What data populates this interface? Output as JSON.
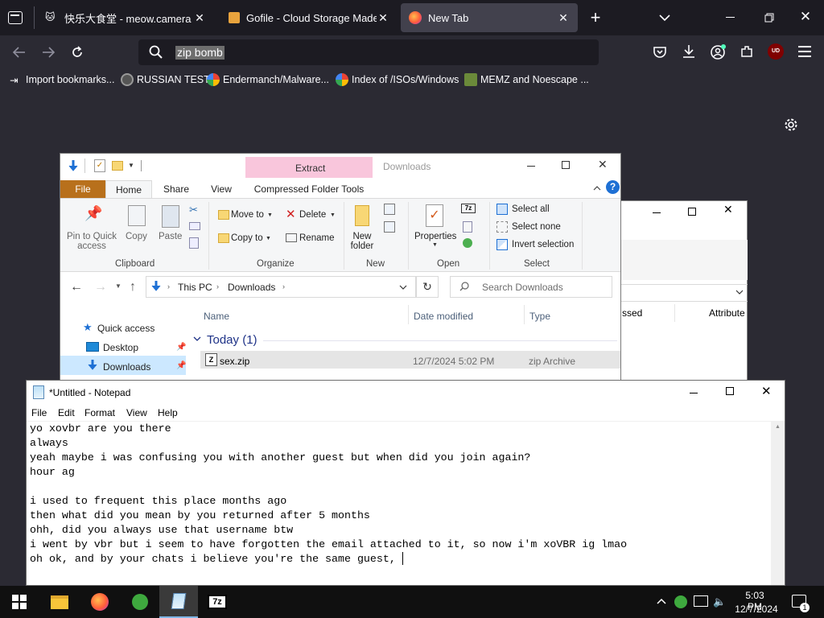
{
  "browser": {
    "tabs": [
      {
        "title": "快乐大食堂 - meow.camera",
        "active": false
      },
      {
        "title": "Gofile - Cloud Storage Made Sim",
        "active": false
      },
      {
        "title": "New Tab",
        "active": true
      }
    ],
    "url_text": "zip bomb",
    "bookmarks": [
      {
        "label": "Import bookmarks..."
      },
      {
        "label": "RUSSIAN TEST"
      },
      {
        "label": "Endermanch/Malware..."
      },
      {
        "label": "Index of /ISOs/Windows"
      },
      {
        "label": "MEMZ and Noescape ..."
      }
    ],
    "ublock_badge": "UD"
  },
  "explorer": {
    "title": "Downloads",
    "context_tab": "Extract",
    "ribbon_tabs": {
      "file": "File",
      "home": "Home",
      "share": "Share",
      "view": "View",
      "compressed": "Compressed Folder Tools"
    },
    "clipboard": {
      "pin": "Pin to Quick access",
      "copy": "Copy",
      "paste": "Paste",
      "label": "Clipboard"
    },
    "organize": {
      "move_to": "Move to",
      "copy_to": "Copy to",
      "delete": "Delete",
      "rename": "Rename",
      "label": "Organize"
    },
    "new": {
      "new_folder": "New folder",
      "label": "New"
    },
    "open": {
      "properties": "Properties",
      "label": "Open"
    },
    "select": {
      "select_all": "Select all",
      "select_none": "Select none",
      "invert": "Invert selection",
      "label": "Select"
    },
    "breadcrumb": [
      "This PC",
      "Downloads"
    ],
    "search_placeholder": "Search Downloads",
    "columns": {
      "name": "Name",
      "date": "Date modified",
      "type": "Type"
    },
    "group": "Today (1)",
    "nav": {
      "quick_access": "Quick access",
      "desktop": "Desktop",
      "downloads": "Downloads"
    },
    "files": [
      {
        "name": "sex.zip",
        "date": "12/7/2024 5:02 PM",
        "type": "zip Archive"
      }
    ]
  },
  "explorer_back": {
    "col_accessed": "ssed",
    "col_attributes": "Attribute"
  },
  "notepad": {
    "title": "*Untitled - Notepad",
    "menu": {
      "file": "File",
      "edit": "Edit",
      "format": "Format",
      "view": "View",
      "help": "Help"
    },
    "text": "yo xovbr are you there\nalways\nyeah maybe i was confusing you with another guest but when did you join again?\nhour ag\n\ni used to frequent this place months ago\nthen what did you mean by you returned after 5 months\nohh, did you always use that username btw\ni went by vbr but i seem to have forgotten the email attached to it, so now i'm xoVBR ig lmao\noh ok, and by your chats i believe you're the same guest, "
  },
  "taskbar": {
    "time": "5:03 PM",
    "date": "12/7/2024",
    "notification_count": "1",
    "sevenzip": "7z"
  },
  "colors": {
    "firefox_bg": "#2b2a33",
    "tab_active": "#42414d",
    "extract_tab": "#f9c6dc",
    "file_tab": "#b8701c",
    "selected_row": "#e5e5e5"
  }
}
